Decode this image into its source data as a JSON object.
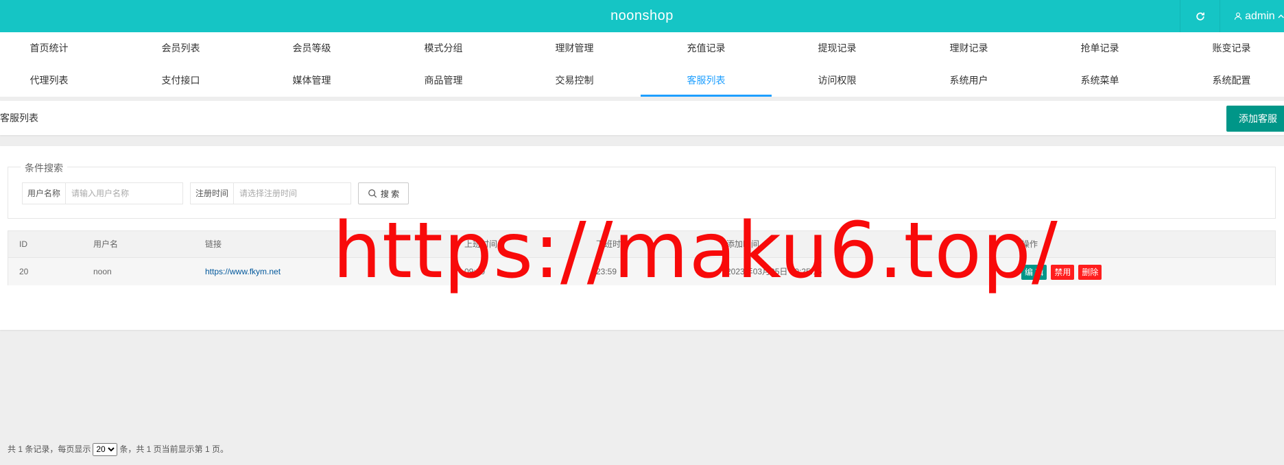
{
  "app": {
    "brand": "noonshop",
    "user": "admin"
  },
  "icons": {
    "refresh": "refresh-icon",
    "user": "user-icon",
    "search": "search-icon",
    "chevron": "chevron-down-icon"
  },
  "nav": {
    "row1": [
      "首页统计",
      "会员列表",
      "会员等级",
      "模式分组",
      "理财管理",
      "充值记录",
      "提现记录",
      "理财记录",
      "抢单记录",
      "账变记录"
    ],
    "row2": [
      "代理列表",
      "支付接口",
      "媒体管理",
      "商品管理",
      "交易控制",
      "客服列表",
      "访问权限",
      "系统用户",
      "系统菜单",
      "系统配置"
    ],
    "active": "客服列表"
  },
  "page": {
    "breadcrumb": "客服列表",
    "add_button": "添加客服"
  },
  "search": {
    "legend": "条件搜索",
    "username_label": "用户名称",
    "username_placeholder": "请输入用户名称",
    "regtime_label": "注册时间",
    "regtime_placeholder": "请选择注册时间",
    "button": "搜 索"
  },
  "table": {
    "headers": [
      "ID",
      "用户名",
      "链接",
      "上班时间",
      "下班时间",
      "添加时间",
      "操作"
    ],
    "rows": [
      {
        "id": "20",
        "username": "noon",
        "link": "https://www.fkym.net",
        "start": "09:00",
        "end": "23:59",
        "added": "2023年03月05日 10:25:15"
      }
    ],
    "actions": {
      "edit": "编 辑",
      "disable": "禁用",
      "delete": "删除"
    }
  },
  "pager": {
    "prefix": "共 1 条记录，每页显示",
    "page_size": "20",
    "suffix": "条，共 1 页当前显示第 1 页。"
  },
  "watermark": "https://maku6.top/",
  "colors": {
    "header": "#15c5c5",
    "active": "#1e9fff",
    "primary": "#009688",
    "danger": "#ff1e1e",
    "watermark": "#f80a0a"
  }
}
